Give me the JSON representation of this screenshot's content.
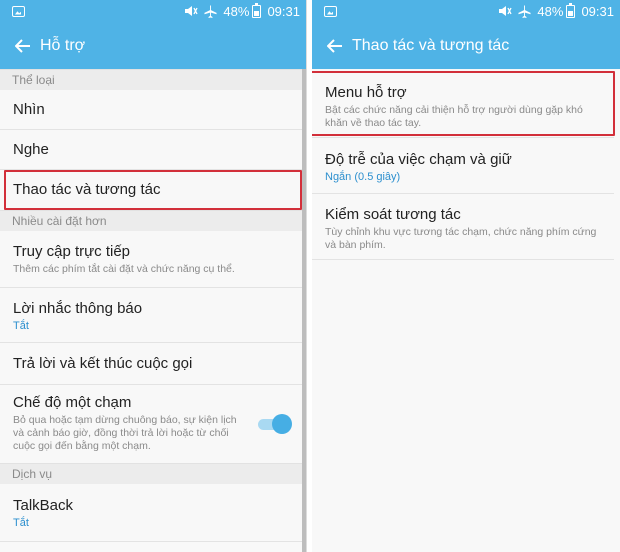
{
  "left": {
    "status": {
      "battery": "48%",
      "time": "09:31"
    },
    "title": "Hỗ trợ",
    "section1": "Thể loại",
    "items1": [
      {
        "label": "Nhìn"
      },
      {
        "label": "Nghe"
      },
      {
        "label": "Thao tác và tương tác"
      }
    ],
    "section2": "Nhiều cài đặt hơn",
    "items2": [
      {
        "label": "Truy cập trực tiếp",
        "sub": "Thêm các phím tắt cài đặt và chức năng cụ thể."
      },
      {
        "label": "Lời nhắc thông báo",
        "val": "Tắt"
      },
      {
        "label": "Trả lời và kết thúc cuộc gọi"
      },
      {
        "label": "Chế độ một chạm",
        "sub": "Bỏ qua hoặc tạm dừng chuông báo, sự kiện lịch và cảnh báo giờ, đồng thời trả lời hoặc từ chối cuộc gọi đến bằng một chạm."
      }
    ],
    "section3": "Dịch vụ",
    "items3": [
      {
        "label": "TalkBack",
        "val": "Tắt"
      }
    ]
  },
  "right": {
    "status": {
      "battery": "48%",
      "time": "09:31"
    },
    "title": "Thao tác và tương tác",
    "items": [
      {
        "label": "Menu hỗ trợ",
        "sub": "Bật các chức năng cải thiện hỗ trợ người dùng gặp khó khăn về thao tác tay."
      },
      {
        "label": "Độ trễ của việc chạm và giữ",
        "val": "Ngắn (0.5 giây)"
      },
      {
        "label": "Kiểm soát tương tác",
        "sub": "Tùy chỉnh khu vực tương tác chạm, chức năng phím cứng và bàn phím."
      }
    ]
  },
  "colors": {
    "header": "#4fb3e6",
    "accent": "#2c8fce",
    "highlight": "#d22f3a"
  }
}
